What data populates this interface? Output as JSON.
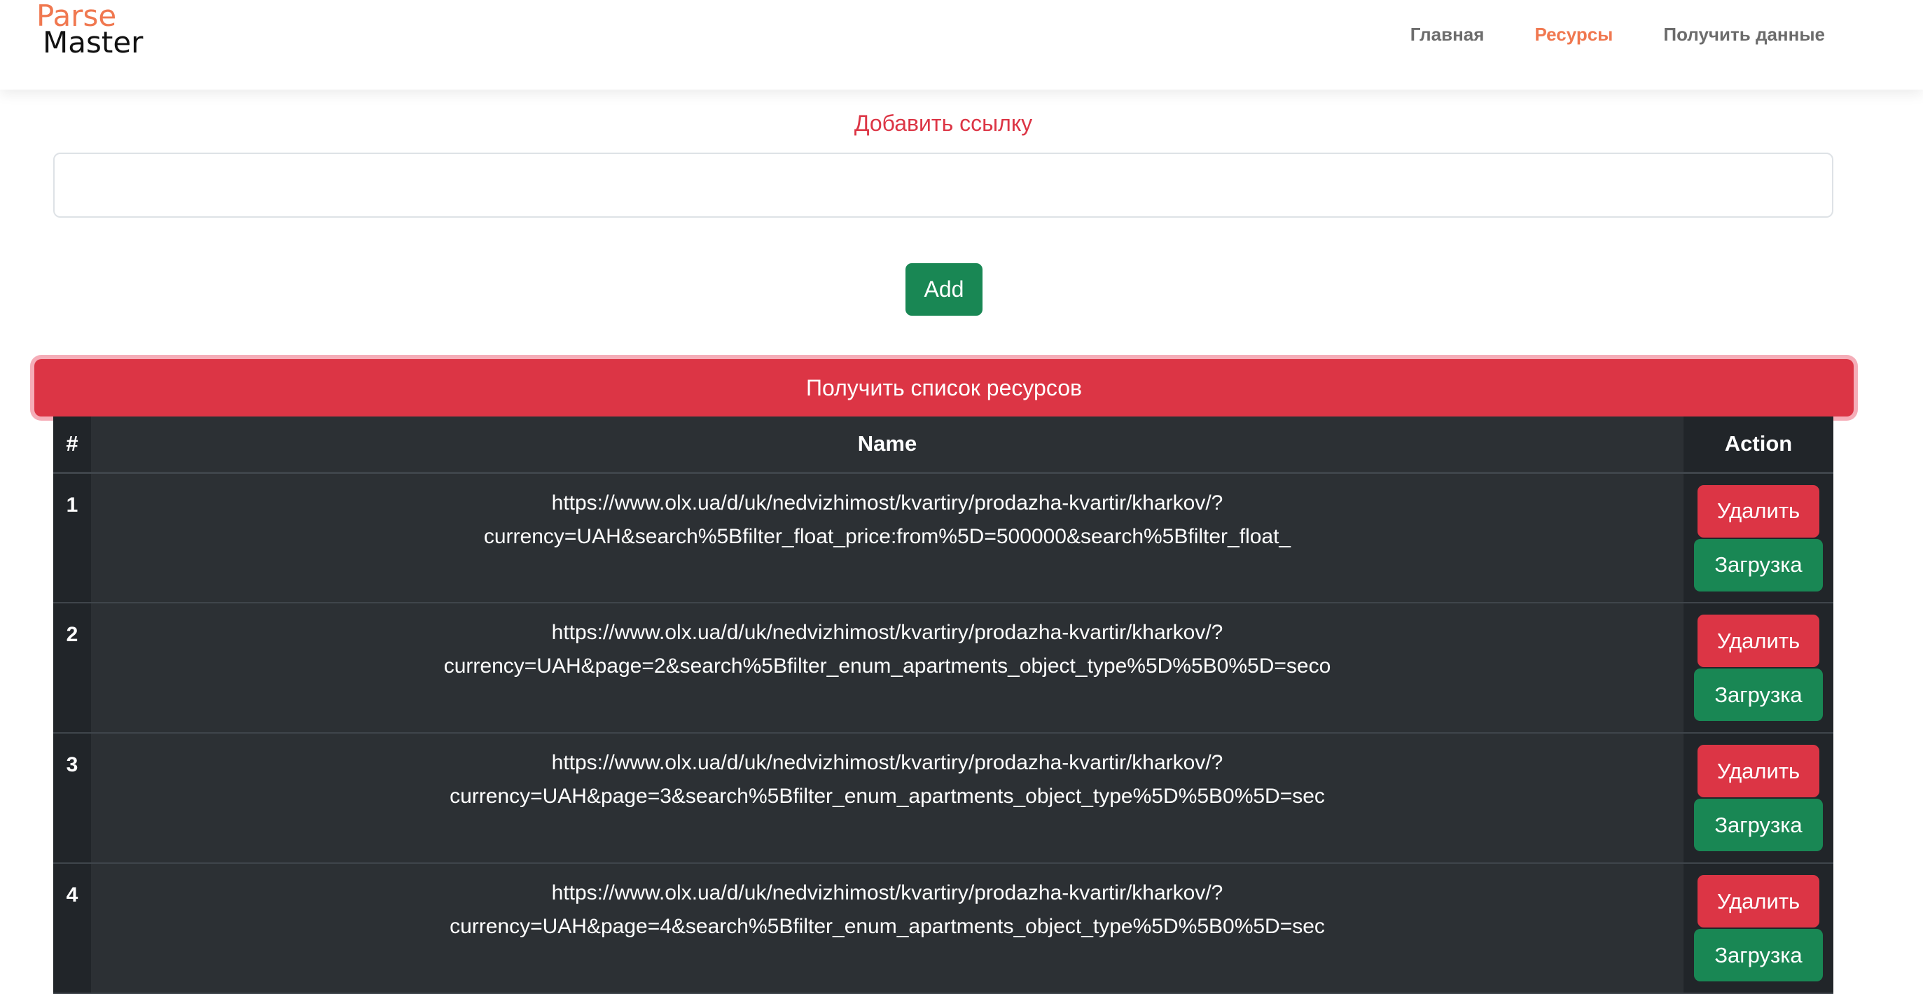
{
  "navbar": {
    "logo_line1": "Parse",
    "logo_line2": "Master",
    "links": [
      {
        "label": "Главная",
        "active": false
      },
      {
        "label": "Ресурсы",
        "active": true
      },
      {
        "label": "Получить данные",
        "active": false
      }
    ]
  },
  "form": {
    "add_label": "Добавить ссылку",
    "input_value": "",
    "add_button": "Add"
  },
  "list_button": "Получить список ресурсов",
  "table": {
    "headers": {
      "num": "#",
      "name": "Name",
      "action": "Action"
    },
    "rows": [
      {
        "num": "1",
        "url_line1": "https://www.olx.ua/d/uk/nedvizhimost/kvartiry/prodazha-kvartir/kharkov/?",
        "url_line2": "currency=UAH&search%5Bfilter_float_price:from%5D=500000&search%5Bfilter_float_",
        "delete_label": "Удалить",
        "load_label": "Загрузка"
      },
      {
        "num": "2",
        "url_line1": "https://www.olx.ua/d/uk/nedvizhimost/kvartiry/prodazha-kvartir/kharkov/?",
        "url_line2": "currency=UAH&page=2&search%5Bfilter_enum_apartments_object_type%5D%5B0%5D=seco",
        "delete_label": "Удалить",
        "load_label": "Загрузка"
      },
      {
        "num": "3",
        "url_line1": "https://www.olx.ua/d/uk/nedvizhimost/kvartiry/prodazha-kvartir/kharkov/?",
        "url_line2": "currency=UAH&page=3&search%5Bfilter_enum_apartments_object_type%5D%5B0%5D=sec",
        "delete_label": "Удалить",
        "load_label": "Загрузка"
      },
      {
        "num": "4",
        "url_line1": "https://www.olx.ua/d/uk/nedvizhimost/kvartiry/prodazha-kvartir/kharkov/?",
        "url_line2": "currency=UAH&page=4&search%5Bfilter_enum_apartments_object_type%5D%5B0%5D=sec",
        "delete_label": "Удалить",
        "load_label": "Загрузка"
      }
    ]
  },
  "colors": {
    "accent": "#f07850",
    "danger": "#dc3545",
    "success": "#198754",
    "table_bg": "#2c3034"
  }
}
